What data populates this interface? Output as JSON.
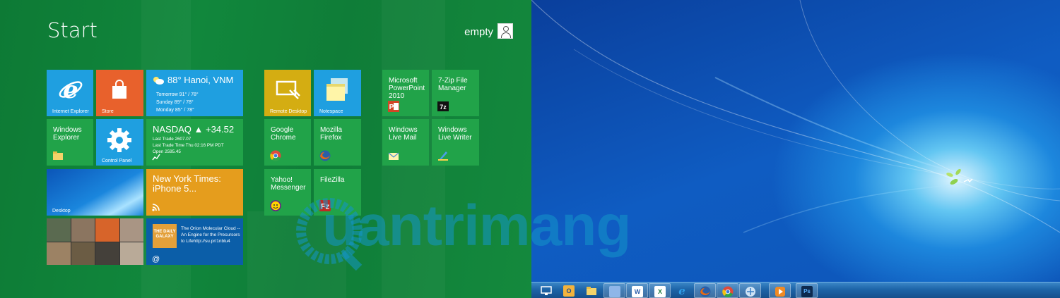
{
  "start": {
    "title": "Start",
    "user": "empty",
    "tiles": {
      "ie": "Internet Explorer",
      "store": "Store",
      "weather_main": "88° Hanoi, VNM",
      "weather_rows": [
        "Tomorrow 91° / 78°",
        "Sunday   89° / 78°",
        "Monday   85° / 78°"
      ],
      "explorer": "Windows Explorer",
      "control_panel": "Control Panel",
      "nasdaq_main": "NASDAQ ▲ +34.52",
      "nasdaq_lines": [
        "Last Trade 2607.07",
        "Last Trade Time Thu 02:16 PM PDT",
        "Open 2595.45"
      ],
      "desktop": "Desktop",
      "nyt": "New York Times: iPhone 5...",
      "galaxy_logo": "THE DAILY GALAXY",
      "galaxy_text": "The Orion Molecular Cloud -- An Engine for the Precursors to Lifehttp://su.pr/1nblu4",
      "remote_desktop": "Remote Desktop",
      "notespace": "Notespace",
      "chrome": "Google Chrome",
      "firefox": "Mozilla Firefox",
      "yahoo": "Yahoo! Messenger",
      "filezilla": "FileZilla",
      "powerpoint": "Microsoft PowerPoint 2010",
      "sevenzip": "7-Zip File Manager",
      "livemail": "Windows Live Mail",
      "livewriter": "Windows Live Writer"
    }
  },
  "watermark": "uantrimang",
  "taskbar": {
    "items": [
      "show-desktop",
      "outlook",
      "explorer",
      "virtualbox",
      "word",
      "excel",
      "internet-explorer",
      "firefox",
      "chrome",
      "network",
      "media-player",
      "photoshop"
    ],
    "word_glyph": "W",
    "excel_glyph": "X",
    "ps_glyph": "Ps"
  },
  "colors": {
    "start_bg": "#11873c",
    "tile_green": "#21a349",
    "tile_blue": "#1f9fe0",
    "store_orange": "#e8612c",
    "remote_yellow": "#d4ad12",
    "nyt_orange": "#e59d1d",
    "galaxy_blue": "#0b5ea8"
  }
}
